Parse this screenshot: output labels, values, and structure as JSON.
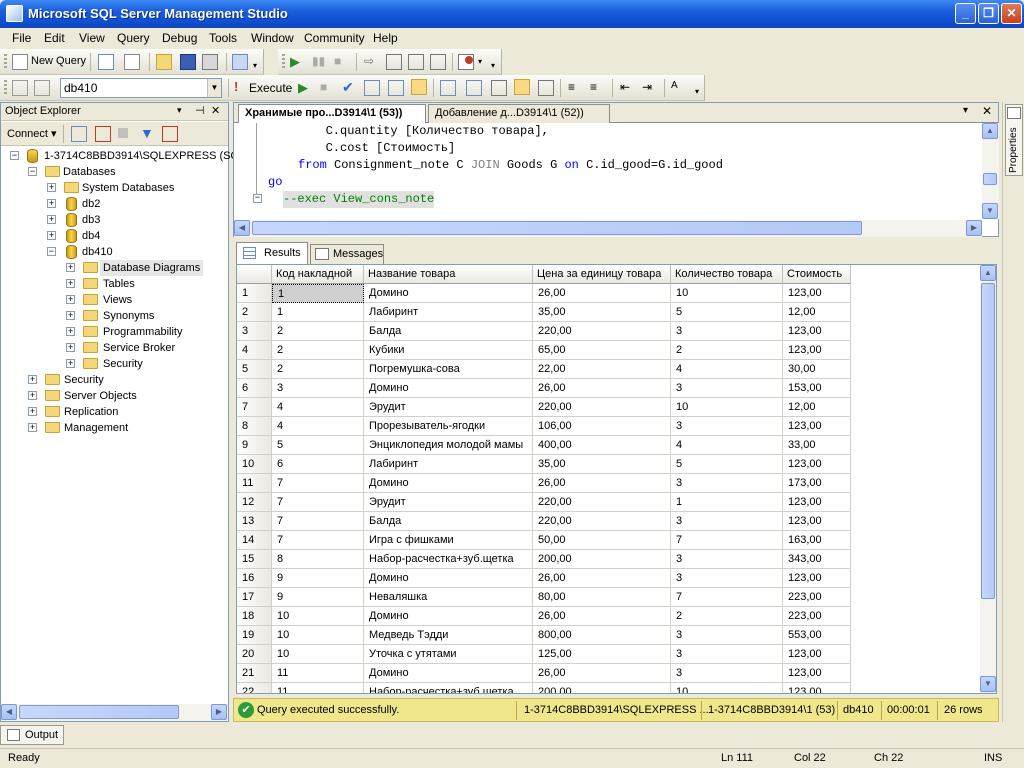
{
  "app": {
    "title": "Microsoft SQL Server Management Studio"
  },
  "window_buttons": {
    "min": "_",
    "max": "❐",
    "close": "✕"
  },
  "menu": [
    "File",
    "Edit",
    "View",
    "Query",
    "Debug",
    "Tools",
    "Window",
    "Community",
    "Help"
  ],
  "toolbar": {
    "new_query": "New Query",
    "database": "db410",
    "execute": "Execute"
  },
  "object_explorer": {
    "title": "Object Explorer",
    "connect": "Connect ▾",
    "tree": [
      {
        "label": "1-3714C8BBD3914\\SQLEXPRESS (SQL",
        "toggle": "−"
      },
      {
        "label": "Databases",
        "toggle": "−"
      },
      {
        "label": "System Databases",
        "toggle": "+"
      },
      {
        "label": "db2",
        "toggle": "+"
      },
      {
        "label": "db3",
        "toggle": "+"
      },
      {
        "label": "db4",
        "toggle": "+"
      },
      {
        "label": "db410",
        "toggle": "−"
      },
      {
        "label": "Database Diagrams",
        "toggle": "+"
      },
      {
        "label": "Tables",
        "toggle": "+"
      },
      {
        "label": "Views",
        "toggle": "+"
      },
      {
        "label": "Synonyms",
        "toggle": "+"
      },
      {
        "label": "Programmability",
        "toggle": "+"
      },
      {
        "label": "Service Broker",
        "toggle": "+"
      },
      {
        "label": "Security",
        "toggle": "+"
      },
      {
        "label": "Security",
        "toggle": "+"
      },
      {
        "label": "Server Objects",
        "toggle": "+"
      },
      {
        "label": "Replication",
        "toggle": "+"
      },
      {
        "label": "Management",
        "toggle": "+"
      }
    ]
  },
  "editor": {
    "tabs": [
      "Хранимые про...D3914\\1 (53))",
      "Добавление д...D3914\\1 (52))"
    ],
    "lines": [
      {
        "a": "        C.quantity [Количество товара],"
      },
      {
        "a": "        C.cost [Стоимость]"
      },
      {
        "kw1": "from",
        "t1": " Consignment_note C ",
        "kw2": "JOIN",
        "t2": " Goods G ",
        "kw3": "on",
        "t3": " C.id_good=G.id_good"
      },
      {
        "a": "go"
      },
      {
        "a": "--exec View_cons_note"
      }
    ]
  },
  "results": {
    "tab_results": "Results",
    "tab_messages": "Messages",
    "columns": [
      "Код накладной",
      "Название товара",
      "Цена за единицу товара",
      "Количество товара",
      "Стоимость"
    ],
    "rows": [
      [
        "1",
        "1",
        "Домино",
        "26,00",
        "10",
        "123,00"
      ],
      [
        "2",
        "1",
        "Лабиринт",
        "35,00",
        "5",
        "12,00"
      ],
      [
        "3",
        "2",
        "Балда",
        "220,00",
        "3",
        "123,00"
      ],
      [
        "4",
        "2",
        "Кубики",
        "65,00",
        "2",
        "123,00"
      ],
      [
        "5",
        "2",
        "Погремушка-сова",
        "22,00",
        "4",
        "30,00"
      ],
      [
        "6",
        "3",
        "Домино",
        "26,00",
        "3",
        "153,00"
      ],
      [
        "7",
        "4",
        "Эрудит",
        "220,00",
        "10",
        "12,00"
      ],
      [
        "8",
        "4",
        "Прорезыватель-ягодки",
        "106,00",
        "3",
        "123,00"
      ],
      [
        "9",
        "5",
        "Энциклопедия молодой мамы",
        "400,00",
        "4",
        "33,00"
      ],
      [
        "10",
        "6",
        "Лабиринт",
        "35,00",
        "5",
        "123,00"
      ],
      [
        "11",
        "7",
        "Домино",
        "26,00",
        "3",
        "173,00"
      ],
      [
        "12",
        "7",
        "Эрудит",
        "220,00",
        "1",
        "123,00"
      ],
      [
        "13",
        "7",
        "Балда",
        "220,00",
        "3",
        "123,00"
      ],
      [
        "14",
        "7",
        "Игра с фишками",
        "50,00",
        "7",
        "163,00"
      ],
      [
        "15",
        "8",
        "Набор-расчестка+зуб.щетка",
        "200,00",
        "3",
        "343,00"
      ],
      [
        "16",
        "9",
        "Домино",
        "26,00",
        "3",
        "123,00"
      ],
      [
        "17",
        "9",
        "Неваляшка",
        "80,00",
        "7",
        "223,00"
      ],
      [
        "18",
        "10",
        "Домино",
        "26,00",
        "2",
        "223,00"
      ],
      [
        "19",
        "10",
        "Медведь Тэдди",
        "800,00",
        "3",
        "553,00"
      ],
      [
        "20",
        "10",
        "Уточка с утятами",
        "125,00",
        "3",
        "123,00"
      ],
      [
        "21",
        "11",
        "Домино",
        "26,00",
        "3",
        "123,00"
      ],
      [
        "22",
        "11",
        "Набор-расчестка+зуб.щетка",
        "200,00",
        "10",
        "123,00"
      ]
    ]
  },
  "query_status": {
    "message": "Query executed successfully.",
    "server": "1-3714C8BBD3914\\SQLEXPRESS ...",
    "user": "1-3714C8BBD3914\\1 (53)",
    "db": "db410",
    "time": "00:00:01",
    "rows": "26 rows"
  },
  "output_tab": "Output",
  "properties_tab": "Properties",
  "statusbar": {
    "ready": "Ready",
    "ln": "Ln 111",
    "col": "Col 22",
    "ch": "Ch 22",
    "mode": "INS"
  },
  "colors": {
    "title_blue": "#0d4ccf",
    "status_yellow": "#f0e68c",
    "keyword": "#0000ff",
    "comment": "#008000"
  }
}
